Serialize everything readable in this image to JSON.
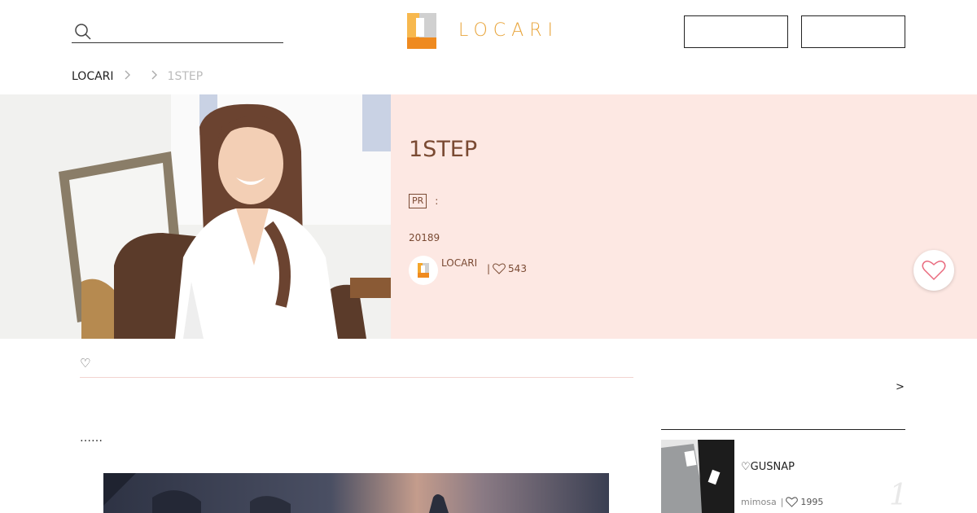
{
  "header": {
    "search_placeholder": "",
    "logo_text": "LOCARI",
    "buttons": [
      "",
      ""
    ]
  },
  "breadcrumb": {
    "home": "LOCARI",
    "separator": ">",
    "current": "1STEP"
  },
  "hero": {
    "title": "1STEP",
    "pr_badge": "PR",
    "pr_colon": ":",
    "date": "20189",
    "author_name": "LOCARI",
    "likes_pipe": "|",
    "likes": "543"
  },
  "article": {
    "intro_text": "♡",
    "ellipsis": "……"
  },
  "sidebar": {
    "more_link": ">",
    "items": [
      {
        "title": "♡GUSNAP",
        "author": "mimosa",
        "pipe": "|",
        "likes": "1995",
        "rank": "1"
      }
    ]
  },
  "colors": {
    "accent": "#e8a53c",
    "hero_bg": "#fde8e3",
    "hero_text": "#7a4a33",
    "heart": "#e96a7e"
  }
}
